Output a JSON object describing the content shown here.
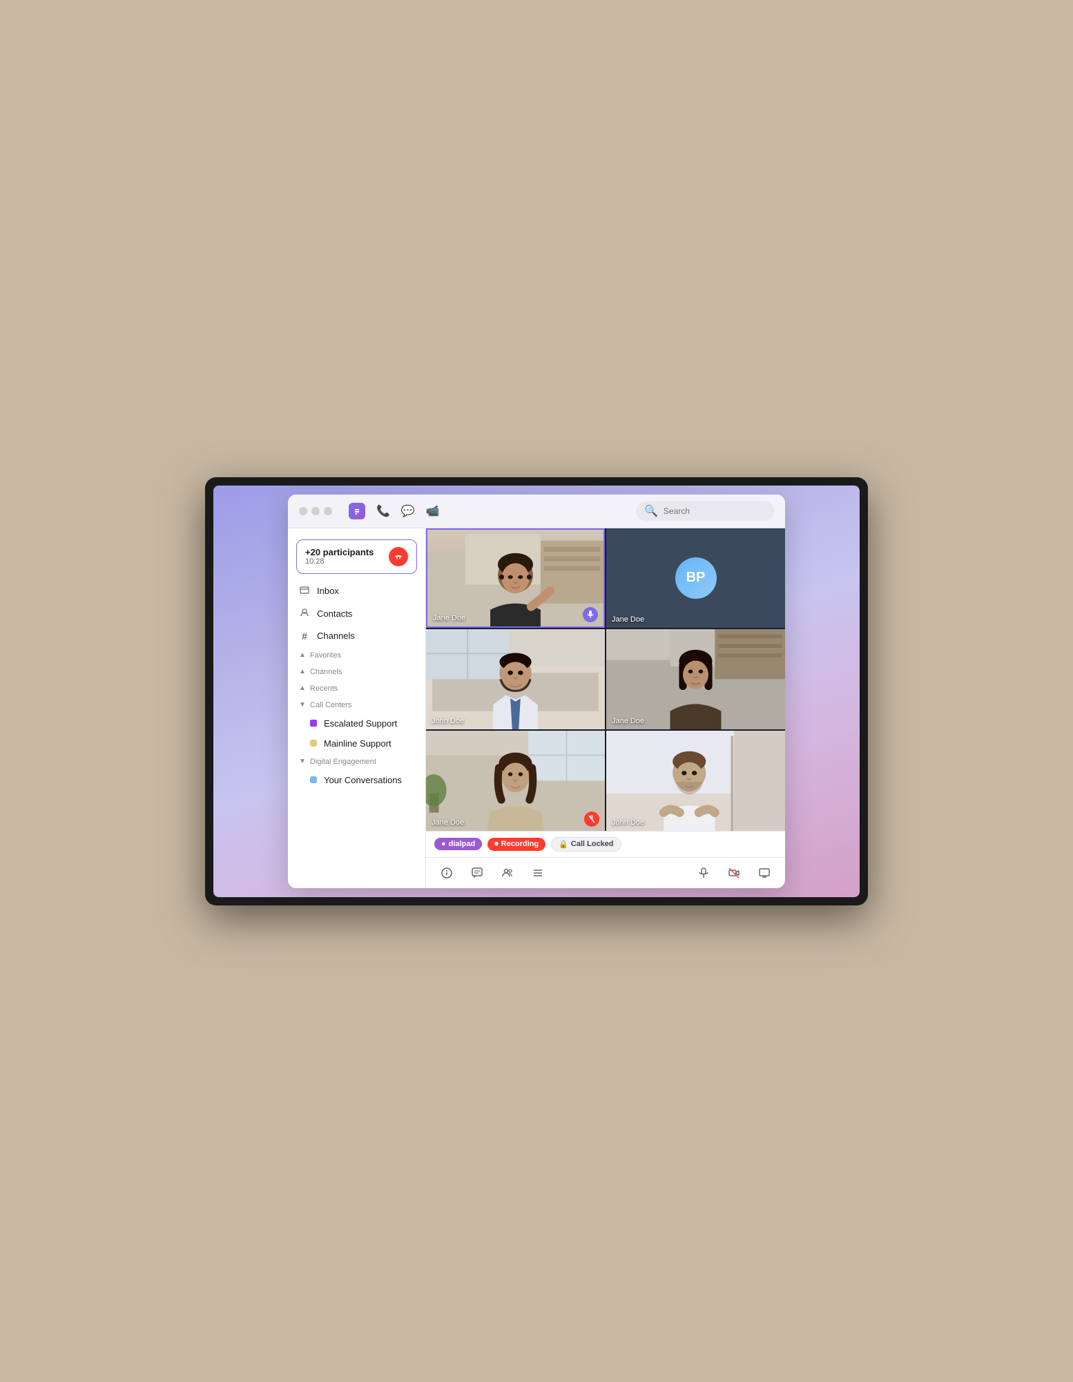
{
  "window": {
    "title": "Dialpad"
  },
  "titlebar": {
    "search_placeholder": "Search"
  },
  "call_banner": {
    "participants": "+20 participants",
    "timer": "10:28",
    "end_label": "✕"
  },
  "sidebar": {
    "items": [
      {
        "id": "inbox",
        "label": "Inbox",
        "icon": "📥"
      },
      {
        "id": "contacts",
        "label": "Contacts",
        "icon": "👤"
      },
      {
        "id": "channels",
        "label": "Channels",
        "icon": "#"
      }
    ],
    "sections": [
      {
        "id": "favorites",
        "label": "Favorites",
        "expanded": false,
        "children": []
      },
      {
        "id": "channels",
        "label": "Channels",
        "expanded": false,
        "children": []
      },
      {
        "id": "recents",
        "label": "Recents",
        "expanded": false,
        "children": []
      },
      {
        "id": "call-centers",
        "label": "Call Centers",
        "expanded": true,
        "children": [
          {
            "id": "escalated-support",
            "label": "Escalated Support",
            "color": "#9b3de8"
          },
          {
            "id": "mainline-support",
            "label": "Mainline Support",
            "color": "#e8c87a"
          }
        ]
      },
      {
        "id": "digital-engagement",
        "label": "Digital Engagement",
        "expanded": true,
        "children": [
          {
            "id": "your-conversations",
            "label": "Your Conversations",
            "color": "#7ab8e8"
          }
        ]
      }
    ]
  },
  "video_grid": {
    "cells": [
      {
        "id": "cell-1",
        "name": "Jane Doe",
        "active": true,
        "mic": "active",
        "position": "1"
      },
      {
        "id": "cell-2",
        "name": "Jane Doe",
        "active": false,
        "mic": null,
        "position": "2",
        "avatar": "BP"
      },
      {
        "id": "cell-3",
        "name": "John Doe",
        "active": false,
        "mic": null,
        "position": "3"
      },
      {
        "id": "cell-4",
        "name": "Jane Doe",
        "active": false,
        "mic": null,
        "position": "4"
      },
      {
        "id": "cell-5",
        "name": "Jane Doe",
        "active": false,
        "mic": "muted",
        "position": "5"
      },
      {
        "id": "cell-6",
        "name": "John Doe",
        "active": false,
        "mic": null,
        "position": "6"
      }
    ]
  },
  "status_badges": [
    {
      "id": "dialpad-badge",
      "label": "dialpad",
      "type": "dialpad",
      "icon": "●"
    },
    {
      "id": "recording-badge",
      "label": "Recording",
      "type": "recording",
      "icon": "⏺"
    },
    {
      "id": "locked-badge",
      "label": "Call Locked",
      "type": "locked",
      "icon": "🔒"
    }
  ],
  "toolbar": {
    "left_icons": [
      {
        "id": "info-icon",
        "icon": "ℹ",
        "label": "Info"
      },
      {
        "id": "chat-icon",
        "icon": "💬",
        "label": "Chat"
      },
      {
        "id": "people-icon",
        "icon": "👥",
        "label": "People"
      },
      {
        "id": "settings-icon",
        "icon": "≡",
        "label": "Settings"
      }
    ],
    "right_icons": [
      {
        "id": "mute-icon",
        "icon": "🎤",
        "label": "Mute"
      },
      {
        "id": "video-off-icon",
        "icon": "📷",
        "label": "Video"
      },
      {
        "id": "screenshare-icon",
        "icon": "⬛",
        "label": "Screen Share"
      }
    ]
  }
}
